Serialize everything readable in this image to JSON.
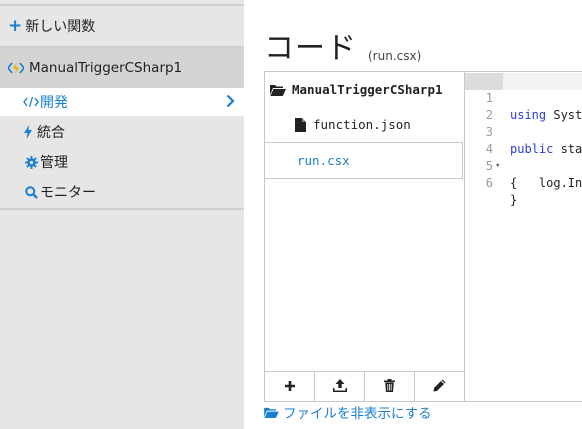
{
  "sidebar": {
    "new_function_label": "新しい関数",
    "function_name": "ManualTriggerCSharp1",
    "nav": [
      {
        "label": "開発",
        "icon": "code-icon",
        "active": true
      },
      {
        "label": "統合",
        "icon": "bolt-icon",
        "active": false
      },
      {
        "label": "管理",
        "icon": "gear-icon",
        "active": false
      },
      {
        "label": "モニター",
        "icon": "search-icon",
        "active": false
      }
    ]
  },
  "main": {
    "title": "コード",
    "subtitle": "(run.csx)",
    "files": {
      "root": "ManualTriggerCSharp1",
      "items": [
        "function.json",
        "run.csx"
      ],
      "selected": "run.csx",
      "toolbar": [
        "add-icon",
        "upload-icon",
        "delete-icon",
        "edit-icon"
      ]
    },
    "editor": {
      "lines": [
        {
          "n": "1",
          "kw": "using",
          "text": " System;"
        },
        {
          "n": "2",
          "kw": "",
          "text": ""
        },
        {
          "n": "3",
          "kw": "public",
          "text": " static void Run(string input, TraceWriter log)"
        },
        {
          "n": "4",
          "kw": "",
          "text": "{",
          "fold": "▾"
        },
        {
          "n": "5",
          "kw": "",
          "text": "    log.Info($\"C# manually triggered function called with input: {input}\");"
        },
        {
          "n": "6",
          "kw": "",
          "text": "}"
        }
      ]
    },
    "hide_files_label": "ファイルを非表示にする"
  },
  "colors": {
    "accent": "#1a7fd1",
    "sidebar_bg": "#e6e6e6",
    "function_row_bg": "#d4d4d4",
    "keyword": "#2f3fd6"
  }
}
